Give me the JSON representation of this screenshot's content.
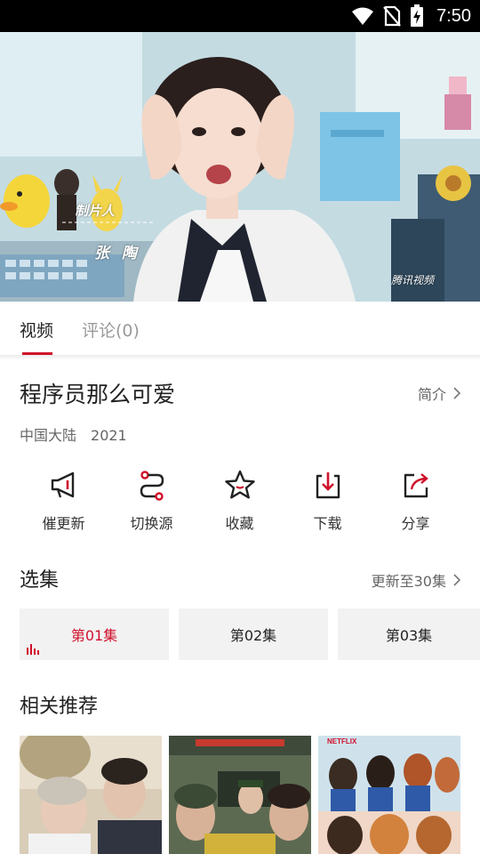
{
  "status_bar": {
    "time": "7:50"
  },
  "video": {
    "caption_role": "制片人",
    "caption_names": "张 陶",
    "watermark": "腾讯视频"
  },
  "tabs": [
    {
      "label": "视频",
      "active": true
    },
    {
      "label": "评论(0)",
      "active": false
    }
  ],
  "show": {
    "title": "程序员那么可爱",
    "intro_label": "简介",
    "region": "中国大陆",
    "year": "2021"
  },
  "actions": [
    {
      "label": "催更新",
      "icon": "megaphone-icon"
    },
    {
      "label": "切换源",
      "icon": "switch-source-icon"
    },
    {
      "label": "收藏",
      "icon": "star-icon"
    },
    {
      "label": "下载",
      "icon": "download-icon"
    },
    {
      "label": "分享",
      "icon": "share-icon"
    }
  ],
  "episodes": {
    "title": "选集",
    "update_status": "更新至30集",
    "items": [
      {
        "label": "第01集",
        "active": true
      },
      {
        "label": "第02集",
        "active": false
      },
      {
        "label": "第03集",
        "active": false
      }
    ]
  },
  "recommendations": {
    "title": "相关推荐",
    "poster3_badge": "NETFLIX"
  },
  "colors": {
    "accent": "#d0112b",
    "text": "#222222",
    "muted": "#666666",
    "chip_bg": "#f2f2f2"
  }
}
